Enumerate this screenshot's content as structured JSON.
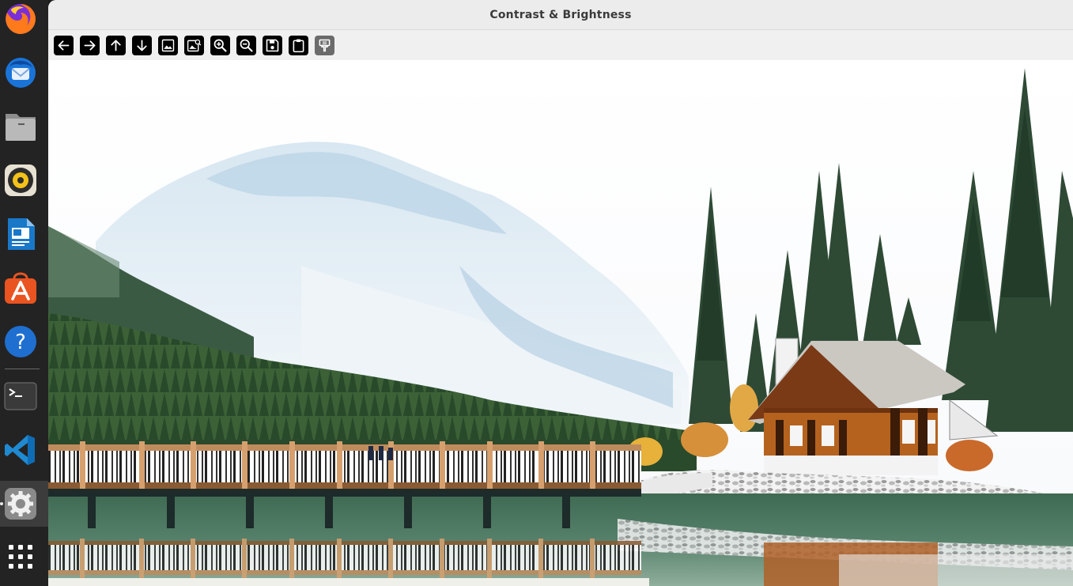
{
  "window": {
    "title": "Contrast & Brightness"
  },
  "dock": {
    "items": [
      {
        "name": "firefox",
        "icon": "firefox-icon"
      },
      {
        "name": "thunderbird",
        "icon": "thunderbird-icon"
      },
      {
        "name": "files",
        "icon": "files-icon"
      },
      {
        "name": "rhythmbox",
        "icon": "rhythmbox-icon"
      },
      {
        "name": "writer",
        "icon": "libreoffice-writer-icon"
      },
      {
        "name": "software",
        "icon": "app-center-icon"
      },
      {
        "name": "help",
        "icon": "help-icon"
      },
      {
        "name": "terminal",
        "icon": "terminal-icon"
      },
      {
        "name": "vscode",
        "icon": "vscode-icon"
      },
      {
        "name": "settings",
        "icon": "settings-icon"
      },
      {
        "name": "app-grid",
        "icon": "show-apps-icon"
      }
    ]
  },
  "toolbar": {
    "buttons": [
      {
        "name": "back-button",
        "icon": "arrow-left-icon"
      },
      {
        "name": "forward-button",
        "icon": "arrow-right-icon"
      },
      {
        "name": "up-button",
        "icon": "arrow-up-icon"
      },
      {
        "name": "down-button",
        "icon": "arrow-down-icon"
      },
      {
        "name": "image-button",
        "icon": "image-icon"
      },
      {
        "name": "image-search-button",
        "icon": "image-search-icon"
      },
      {
        "name": "zoom-in-button",
        "icon": "zoom-in-icon"
      },
      {
        "name": "zoom-out-button",
        "icon": "zoom-out-icon"
      },
      {
        "name": "save-button",
        "icon": "save-icon"
      },
      {
        "name": "clipboard-button",
        "icon": "clipboard-icon"
      },
      {
        "name": "paint-button",
        "icon": "paint-bucket-icon"
      }
    ]
  },
  "colors": {
    "dock_bg": "#232323",
    "window_bg": "#f2f2f2",
    "button_bg": "#000000",
    "button_disabled_bg": "#6b6b6b"
  }
}
